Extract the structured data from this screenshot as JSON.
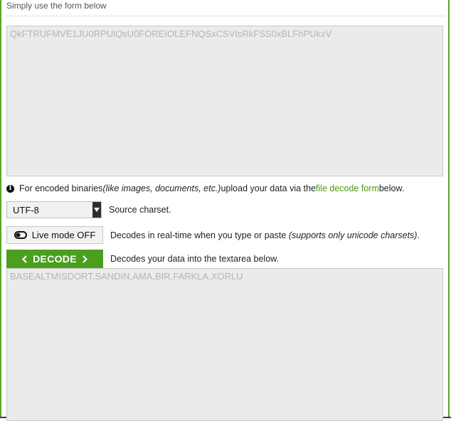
{
  "intro_text": "Simply use the form below",
  "input": {
    "value": "QkFTRUFMVE1JU0RPUlQsU0FOREIOLEFNQSxCSVIsRkFSS0xBLFhPUkxV"
  },
  "note": {
    "prefix": "For encoded binaries ",
    "italic": "(like images, documents, etc.)",
    "middle": " upload your data via the ",
    "link": "file decode form",
    "suffix": " below."
  },
  "charset": {
    "selected": "UTF-8",
    "label": "Source charset."
  },
  "live_mode": {
    "button_label": "Live mode OFF",
    "description": "Decodes in real-time when you type or paste ",
    "description_italic": "(supports only unicode charsets)",
    "description_end": "."
  },
  "decode": {
    "button_label": "DECODE",
    "description": "Decodes your data into the textarea below."
  },
  "output": {
    "value": "BASEALTMISDORT,SANDIN,AMA,BIR,FARKLA,XORLU"
  },
  "colors": {
    "accent": "#4c9e1f",
    "link": "#4e9a06",
    "frame": "#5aa427"
  },
  "icons": {
    "info": "info-circle-icon",
    "toggle": "toggle-off-icon",
    "chevron_left": "chevron-left-icon",
    "chevron_right": "chevron-right-icon",
    "dropdown": "caret-down-icon"
  }
}
